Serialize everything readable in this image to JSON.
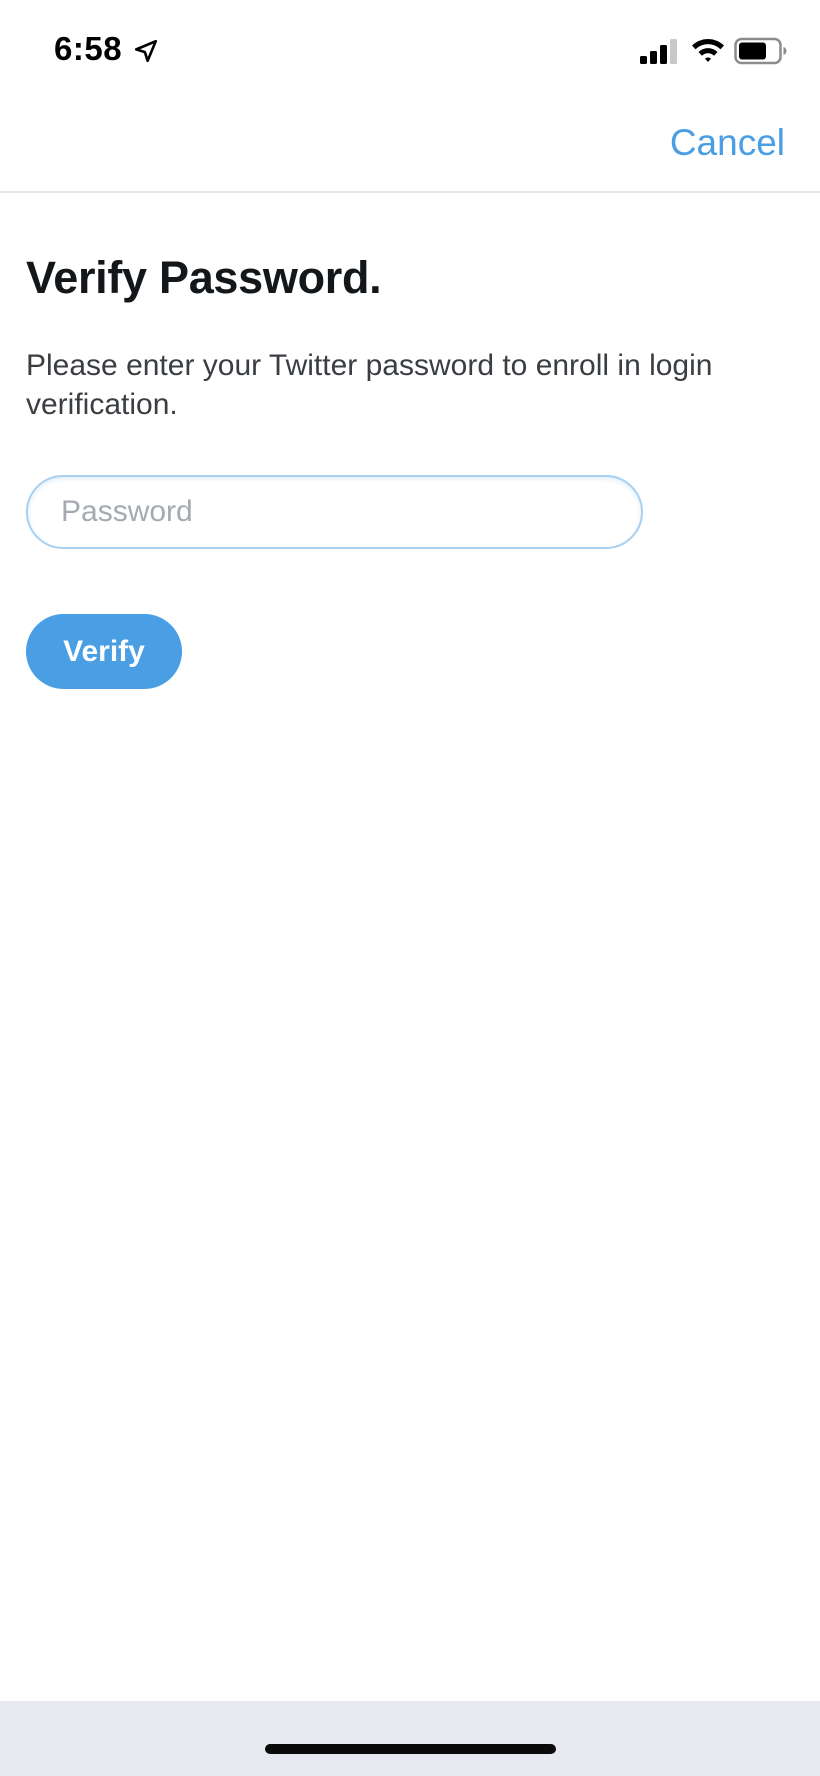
{
  "status_bar": {
    "time": "6:58",
    "icons": [
      "location-arrow-icon",
      "cellular-signal-icon",
      "wifi-icon",
      "battery-icon"
    ]
  },
  "nav": {
    "cancel_label": "Cancel"
  },
  "main": {
    "title": "Verify Password.",
    "description": "Please enter your Twitter password to enroll in login verification.",
    "password_placeholder": "Password",
    "password_value": "",
    "verify_label": "Verify"
  },
  "colors": {
    "accent": "#4a9ee4",
    "text_primary": "#14171a",
    "text_secondary": "#3a3e42",
    "placeholder": "#a4aab0",
    "divider": "#e1e8ed",
    "home_area": "#e6eaf0"
  }
}
